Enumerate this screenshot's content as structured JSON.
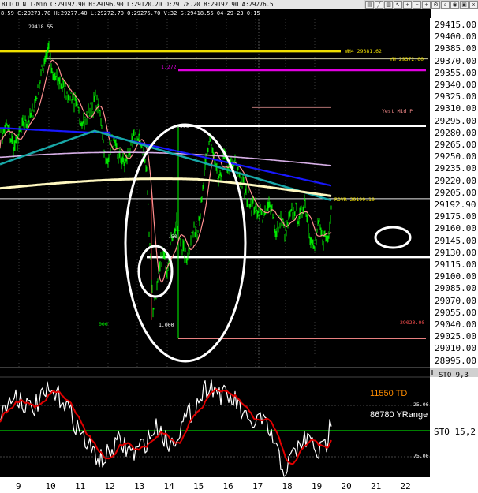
{
  "header": {
    "text": "BITCOIN  1-Min  C:29192.90  H:29196.90  L:29120.20  O:29178.20  B:29192.90  A:29276.5",
    "toolbar_icons": [
      "chart-style-icon",
      "line-icon",
      "bars-icon",
      "cursor-icon",
      "crosshair-icon",
      "minus-icon",
      "plus-icon",
      "settings-icon",
      "zoom-icon",
      "magnet-icon",
      "lock-icon",
      "close-icon"
    ]
  },
  "subheader": {
    "text": "8:59  C:29273.70  H:29277.40  L:29272.70  O:29276.70  V:32  S:29418.55  04-29-23  0:15"
  },
  "top_left_value": "29418.55",
  "last_price": "29192.90",
  "price_axis": [
    "29415.00",
    "29400.00",
    "29385.00",
    "29370.00",
    "29355.00",
    "29340.00",
    "29325.00",
    "29310.00",
    "29295.00",
    "29280.00",
    "29265.00",
    "29250.00",
    "29235.00",
    "29220.00",
    "29205.00",
    "29190.00",
    "29175.00",
    "29160.00",
    "29145.00",
    "29130.00",
    "29115.00",
    "29100.00",
    "29085.00",
    "29070.00",
    "29055.00",
    "29040.00",
    "29025.00",
    "29010.00",
    "28995.00"
  ],
  "time_axis": [
    "9",
    "10",
    "11",
    "12",
    "13",
    "14",
    "15",
    "16",
    "17",
    "18",
    "19",
    "20",
    "21",
    "22"
  ],
  "level_labels": {
    "wh4": "WH4 29381.62",
    "yh": "YH 29372.00",
    "fib_1272": "1.272",
    "yest_mid": "Yest Mid P",
    "fib_000_top": ".000",
    "rovr": "ROVR 29199.10",
    "fib_50": ".50",
    "fib_1000": "1.000",
    "bottom_zero": "000",
    "bottom_right": "29020.00"
  },
  "oscillator": {
    "td_label": "11550 TD",
    "yrange_label": "86780 YRange",
    "sto_label": "STO  15,2",
    "sto_top_label": "STO  9,3",
    "level_25": "25.00",
    "level_75": "75.00"
  },
  "colors": {
    "background": "#000000",
    "axis_bg": "#ffffff",
    "price_line": "#00ff00",
    "ma_teal": "#18a8a8",
    "ma_blue": "#1818ff",
    "ma_lilac": "#d8b0e8",
    "ma_cream": "#fff8c0",
    "ma_pink": "#ff9090",
    "yellow_level": "#f0e000",
    "magenta_level": "#e000e0",
    "td_orange": "#ff8c00",
    "sto_white": "#ffffff",
    "sto_red": "#e00000"
  }
}
